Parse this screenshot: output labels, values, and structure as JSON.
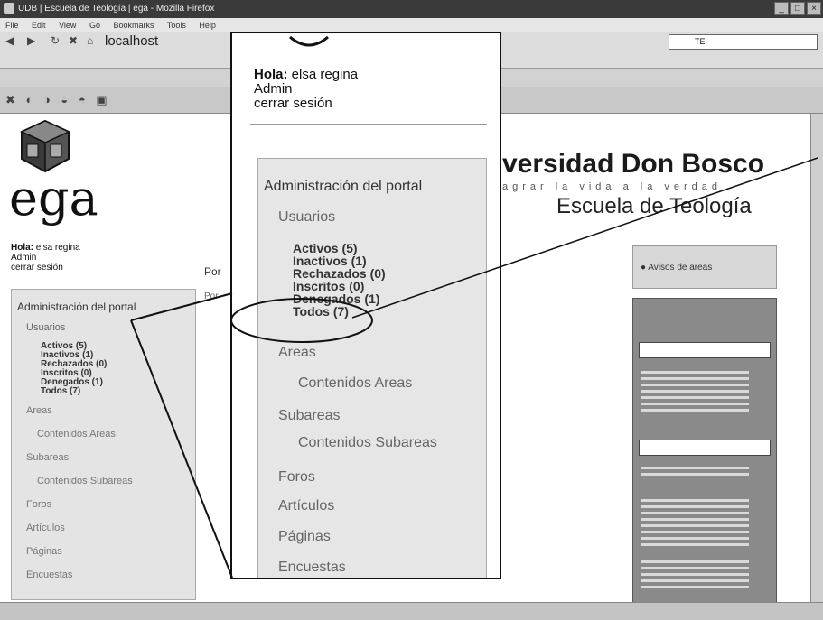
{
  "window": {
    "title": "UDB | Escuela de Teología | ega - Mozilla Firefox",
    "controls": [
      "_",
      "□",
      "×"
    ]
  },
  "menubar": [
    "File",
    "Edit",
    "View",
    "Go",
    "Bookmarks",
    "Tools",
    "Help"
  ],
  "address": {
    "url": "localhost",
    "search_value": "TE"
  },
  "site": {
    "logo_text": "ega",
    "university_name": "versidad Don Bosco",
    "tagline": "agrar la vida a la verdad",
    "school": "Escuela de Teología"
  },
  "user": {
    "greeting_label": "Hola:",
    "greeting_name": "elsa regina",
    "role": "Admin",
    "logout": "cerrar sesión"
  },
  "menu": {
    "title": "Administración del portal",
    "section_users": "Usuarios",
    "users": {
      "active": "Activos (5)",
      "inactive": "Inactivos (1)",
      "rejected": "Rechazados (0)",
      "registered": "Inscritos (0)",
      "denied": "Denegados (1)",
      "all": "Todos (7)"
    },
    "areas": "Areas",
    "areas_content": "Contenidos Areas",
    "subareas": "Subareas",
    "subareas_content": "Contenidos Subareas",
    "forums": "Foros",
    "articles": "Artículos",
    "pages": "Páginas",
    "surveys": "Encuestas"
  },
  "content": {
    "title": "Por",
    "text": "Por"
  },
  "right": {
    "box1": "Avisos de areas"
  },
  "colors": {
    "menu_bg": "#e4e4e4",
    "right_panel_bg": "#8a8a8a",
    "titlebar_bg": "#3a3a3a"
  }
}
